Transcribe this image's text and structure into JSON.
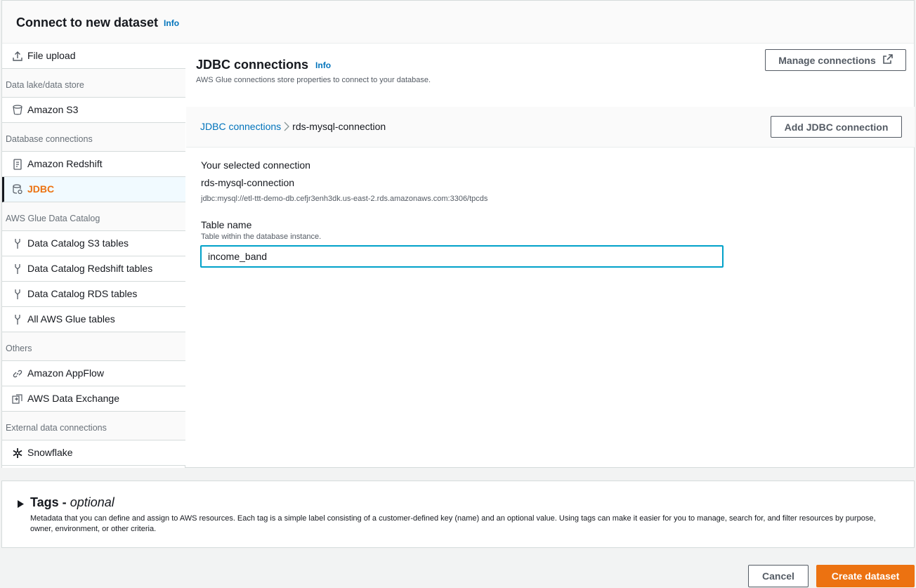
{
  "header": {
    "title": "Connect to new dataset",
    "info": "Info"
  },
  "sidebar": {
    "file_upload": "File upload",
    "sections": {
      "data_lake": "Data lake/data store",
      "database": "Database connections",
      "glue_catalog": "AWS Glue Data Catalog",
      "others": "Others",
      "external": "External data connections"
    },
    "items": {
      "s3": "Amazon S3",
      "redshift": "Amazon Redshift",
      "jdbc": "JDBC",
      "catalog_s3": "Data Catalog S3 tables",
      "catalog_redshift": "Data Catalog Redshift tables",
      "catalog_rds": "Data Catalog RDS tables",
      "all_glue": "All AWS Glue tables",
      "appflow": "Amazon AppFlow",
      "data_exchange": "AWS Data Exchange",
      "snowflake": "Snowflake"
    },
    "selected": "jdbc",
    "accent_color": "#ec7211"
  },
  "content": {
    "title": "JDBC connections",
    "info": "Info",
    "description": "AWS Glue connections store properties to connect to your database.",
    "manage_button": "Manage connections",
    "breadcrumb": {
      "root": "JDBC connections",
      "current": "rds-mysql-connection"
    },
    "add_button": "Add JDBC connection",
    "selected_connection_label": "Your selected connection",
    "connection_name": "rds-mysql-connection",
    "connection_url": "jdbc:mysql://etl-ttt-demo-db.cefjr3enh3dk.us-east-2.rds.amazonaws.com:3306/tpcds",
    "table_label": "Table name",
    "table_hint": "Table within the database instance.",
    "table_value": "income_band"
  },
  "tags": {
    "title": "Tags -",
    "optional": "optional",
    "description": "Metadata that you can define and assign to AWS resources. Each tag is a simple label consisting of a customer-defined key (name) and an optional value. Using tags can make it easier for you to manage, search for, and filter resources by purpose, owner, environment, or other criteria."
  },
  "footer": {
    "cancel": "Cancel",
    "create": "Create dataset",
    "primary_color": "#ec7211"
  }
}
